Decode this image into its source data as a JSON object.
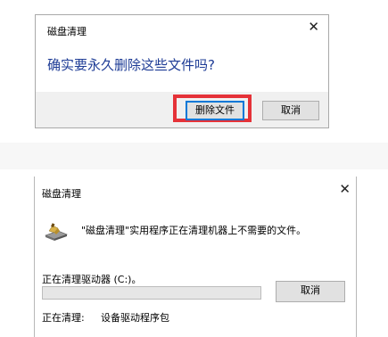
{
  "confirm_dialog": {
    "title": "磁盘清理",
    "close_glyph": "✕",
    "question": "确实要永久删除这些文件吗?",
    "delete_button": "删除文件",
    "cancel_button": "取消",
    "highlight_color": "#e53238"
  },
  "progress_dialog": {
    "title": "磁盘清理",
    "close_glyph": "✕",
    "icon": "disk-cleanup-icon",
    "message": "\"磁盘清理\"实用程序正在清理机器上不需要的文件。",
    "drive_status": "正在清理驱动器  (C:)。",
    "progress_percent": 0,
    "cancel_button": "取消",
    "current_label": "正在清理:",
    "current_item": "设备驱动程序包"
  }
}
